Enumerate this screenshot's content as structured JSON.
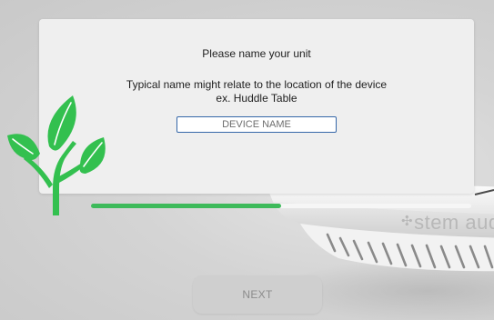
{
  "dialog": {
    "title": "Please name your unit",
    "description_line1": "Typical name might relate to the location of the device",
    "description_line2": "ex. Huddle Table",
    "name_input": {
      "placeholder": "DEVICE NAME",
      "value": ""
    }
  },
  "progress": {
    "fraction": 0.5
  },
  "device": {
    "wordmark": "stem aud",
    "wordmark_icon": "leaf-icon"
  },
  "logo": {
    "icon": "plant-sprout-icon"
  },
  "footer": {
    "next_label": "NEXT"
  },
  "colors": {
    "accent_green": "#3dba5a",
    "input_border": "#3567a8",
    "dialog_background": "#efefef",
    "page_background": "#d4d4d4"
  }
}
